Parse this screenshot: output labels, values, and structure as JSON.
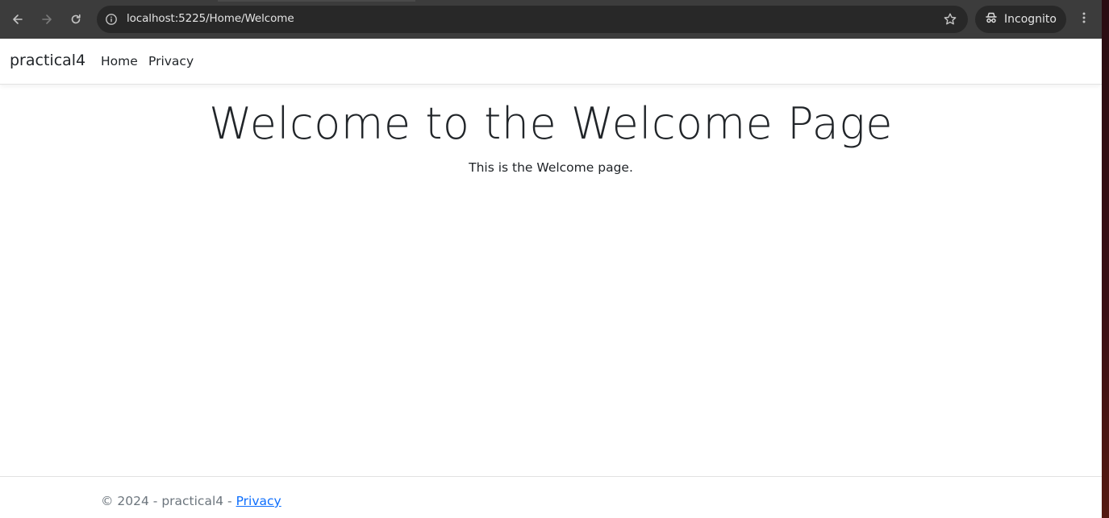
{
  "browser": {
    "url": "localhost:5225/Home/Welcome",
    "profile_label": "Incognito",
    "icons": {
      "back": "arrow-left-icon",
      "forward": "arrow-right-icon",
      "reload": "reload-icon",
      "site_info": "info-icon",
      "bookmark": "star-icon",
      "incognito": "incognito-icon",
      "menu": "kebab-menu-icon"
    }
  },
  "navbar": {
    "brand": "practical4",
    "links": [
      {
        "label": "Home"
      },
      {
        "label": "Privacy"
      }
    ]
  },
  "main": {
    "title": "Welcome to the Welcome Page",
    "subtitle": "This is the Welcome page."
  },
  "footer": {
    "text": "© 2024 - practical4 - ",
    "link_label": "Privacy"
  },
  "colors": {
    "toolbar": "#3c3c3c",
    "omnibox": "#282828",
    "text": "#212529",
    "footer_text": "#6c757d",
    "link": "#0d6efd"
  }
}
